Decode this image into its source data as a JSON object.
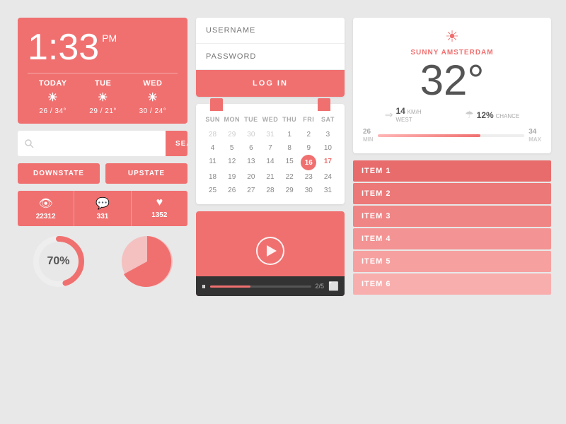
{
  "clock": {
    "time": "1:33",
    "ampm": "PM",
    "days": [
      {
        "label": "TODAY",
        "temp": "26 / 34°"
      },
      {
        "label": "TUE",
        "temp": "29 / 21°"
      },
      {
        "label": "WED",
        "temp": "30 / 24°"
      }
    ]
  },
  "search": {
    "placeholder": "",
    "button_label": "searCH"
  },
  "state_buttons": {
    "downstate": "DOWNSTATE",
    "upstate": "UPSTATE"
  },
  "stats": {
    "views": {
      "value": "22312",
      "icon": "👁"
    },
    "comments": {
      "value": "331",
      "icon": "💬"
    },
    "likes": {
      "value": "1352",
      "icon": "♥"
    }
  },
  "donut": {
    "percentage": "70%",
    "fill_pct": 70
  },
  "login": {
    "username_placeholder": "USERNAME",
    "password_placeholder": "PASSWORD",
    "button_label": "LOG IN"
  },
  "calendar": {
    "headers": [
      "SUN",
      "MON",
      "TUE",
      "WED",
      "THU",
      "FRI",
      "SAT"
    ],
    "days": [
      {
        "num": "28",
        "type": "other"
      },
      {
        "num": "29",
        "type": "other"
      },
      {
        "num": "30",
        "type": "other"
      },
      {
        "num": "31",
        "type": "other"
      },
      {
        "num": "1",
        "type": "normal"
      },
      {
        "num": "2",
        "type": "normal"
      },
      {
        "num": "3",
        "type": "normal"
      },
      {
        "num": "4",
        "type": "normal"
      },
      {
        "num": "5",
        "type": "normal"
      },
      {
        "num": "6",
        "type": "normal"
      },
      {
        "num": "7",
        "type": "normal"
      },
      {
        "num": "8",
        "type": "normal"
      },
      {
        "num": "9",
        "type": "normal"
      },
      {
        "num": "10",
        "type": "normal"
      },
      {
        "num": "11",
        "type": "normal"
      },
      {
        "num": "12",
        "type": "normal"
      },
      {
        "num": "13",
        "type": "normal"
      },
      {
        "num": "14",
        "type": "normal"
      },
      {
        "num": "15",
        "type": "normal"
      },
      {
        "num": "16",
        "type": "today"
      },
      {
        "num": "17",
        "type": "highlight"
      },
      {
        "num": "18",
        "type": "normal"
      },
      {
        "num": "19",
        "type": "normal"
      },
      {
        "num": "20",
        "type": "normal"
      },
      {
        "num": "21",
        "type": "normal"
      },
      {
        "num": "22",
        "type": "normal"
      },
      {
        "num": "23",
        "type": "normal"
      },
      {
        "num": "24",
        "type": "normal"
      },
      {
        "num": "25",
        "type": "normal"
      },
      {
        "num": "26",
        "type": "normal"
      },
      {
        "num": "27",
        "type": "normal"
      },
      {
        "num": "28",
        "type": "normal"
      },
      {
        "num": "29",
        "type": "normal"
      },
      {
        "num": "30",
        "type": "normal"
      },
      {
        "num": "31",
        "type": "normal"
      }
    ]
  },
  "video": {
    "time": "2/5"
  },
  "weather": {
    "location": "SUNNY AMSTERDAM",
    "temperature": "32°",
    "wind_speed": "14",
    "wind_unit": "KM/H",
    "wind_dir": "WEST",
    "rain_chance": "12%",
    "rain_label": "CHANCE",
    "temp_min": "26",
    "temp_max": "34",
    "min_label": "MIN",
    "max_label": "MAX"
  },
  "list_items": [
    {
      "label": "ITEM 1",
      "color": "#e86c6c"
    },
    {
      "label": "ITEM 2",
      "color": "#ec7878"
    },
    {
      "label": "ITEM 3",
      "color": "#f08585"
    },
    {
      "label": "ITEM 4",
      "color": "#f49393"
    },
    {
      "label": "ITEM 5",
      "color": "#f7a0a0"
    },
    {
      "label": "ITEM 6",
      "color": "#f9aeae"
    }
  ],
  "colors": {
    "primary": "#f07070",
    "bg": "#e8e8e8"
  }
}
